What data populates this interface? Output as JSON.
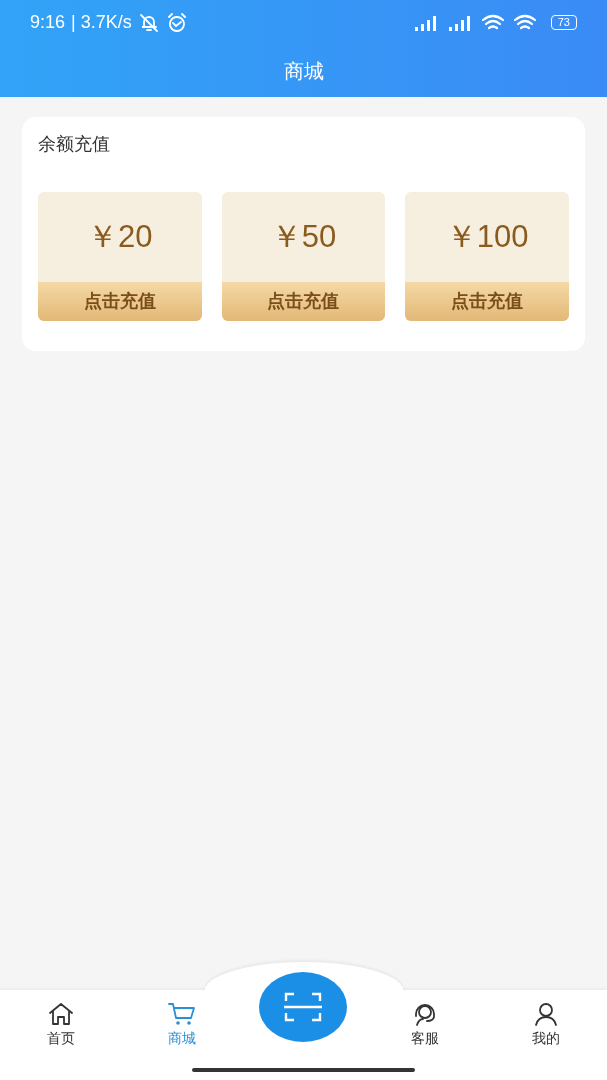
{
  "status_bar": {
    "time": "9:16",
    "speed": "| 3.7K/s",
    "battery": "73"
  },
  "header": {
    "title": "商城"
  },
  "recharge": {
    "title": "余额充值",
    "options": [
      {
        "amount": "￥20",
        "action": "点击充值"
      },
      {
        "amount": "￥50",
        "action": "点击充值"
      },
      {
        "amount": "￥100",
        "action": "点击充值"
      }
    ]
  },
  "tab_bar": [
    {
      "kind": "home",
      "label": "首页",
      "selected": false
    },
    {
      "kind": "cart",
      "label": "商城",
      "selected": true
    },
    {
      "kind": "scan"
    },
    {
      "kind": "service",
      "label": "客服",
      "selected": false
    },
    {
      "kind": "user",
      "label": "我的",
      "selected": false
    }
  ]
}
